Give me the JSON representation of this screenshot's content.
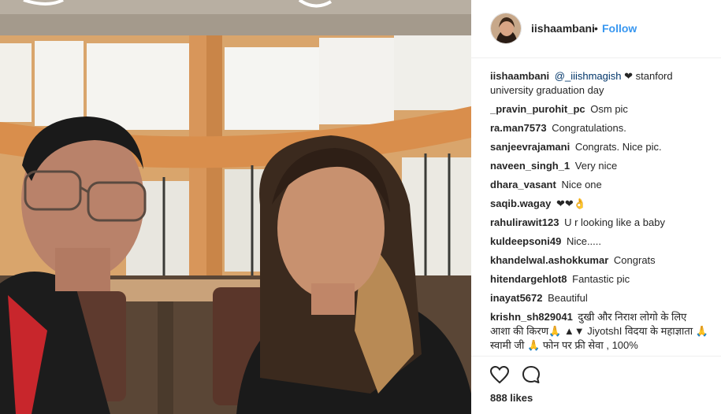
{
  "post": {
    "username": "iishaambani",
    "follow_label": "Follow",
    "separator": "•",
    "likes_text": "888 likes"
  },
  "comments": [
    {
      "user": "iishaambani",
      "mention": "@_iiishmagish",
      "text": "❤ stanford university graduation day"
    },
    {
      "user": "_pravin_purohit_pc",
      "text": "Osm pic"
    },
    {
      "user": "ra.man7573",
      "text": "Congratulations."
    },
    {
      "user": "sanjeevrajamani",
      "text": "Congrats. Nice pic."
    },
    {
      "user": "naveen_singh_1",
      "text": "Very nice"
    },
    {
      "user": "dhara_vasant",
      "text": "Nice one"
    },
    {
      "user": "saqib.wagay",
      "text": "❤❤👌"
    },
    {
      "user": "rahulirawit123",
      "text": "U r looking like a baby"
    },
    {
      "user": "kuldeepsoni49",
      "text": "Nice....."
    },
    {
      "user": "khandelwal.ashokkumar",
      "text": "Congrats"
    },
    {
      "user": "hitendargehlot8",
      "text": "Fantastic pic"
    },
    {
      "user": "inayat5672",
      "text": "Beautiful"
    },
    {
      "user": "krishn_sh829041",
      "text": "दुखी और निराश लोगो के लिए आशा की किरण🙏 ▲▼ JiyotshI विदया के महाज्ञाता 🙏स्वामी जी 🙏 फोन पर फ्री सेवा , 100%"
    }
  ],
  "icons": {
    "like": "heart-icon",
    "comment": "comment-bubble-icon"
  },
  "colors": {
    "follow": "#3897f0",
    "text": "#262626",
    "divider": "#efefef"
  }
}
